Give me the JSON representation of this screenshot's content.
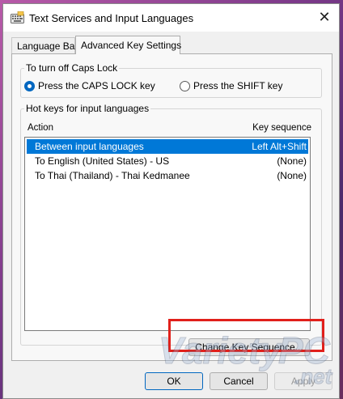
{
  "window": {
    "title": "Text Services and Input Languages",
    "close_glyph": "✕"
  },
  "tabs": [
    {
      "label": "Language Bar",
      "active": false
    },
    {
      "label": "Advanced Key Settings",
      "active": true
    }
  ],
  "caps_lock": {
    "group_label": "To turn off Caps Lock",
    "options": [
      {
        "label": "Press the CAPS LOCK key",
        "checked": true
      },
      {
        "label": "Press the SHIFT key",
        "checked": false
      }
    ]
  },
  "hotkeys": {
    "group_label": "Hot keys for input languages",
    "columns": {
      "action": "Action",
      "key_sequence": "Key sequence"
    },
    "rows": [
      {
        "action": "Between input languages",
        "key_sequence": "Left Alt+Shift",
        "selected": true
      },
      {
        "action": "To English (United States) - US",
        "key_sequence": "(None)",
        "selected": false
      },
      {
        "action": "To Thai (Thailand) - Thai Kedmanee",
        "key_sequence": "(None)",
        "selected": false
      }
    ],
    "change_button": "Change Key Sequence..."
  },
  "footer": {
    "ok": "OK",
    "cancel": "Cancel",
    "apply": "Apply"
  },
  "watermark": {
    "text_main": "Variety",
    "text_pc": "PC",
    "text_net": ".net"
  },
  "colors": {
    "selection": "#0078d7",
    "highlight_box": "#e1201b",
    "accent": "#0067c0"
  }
}
